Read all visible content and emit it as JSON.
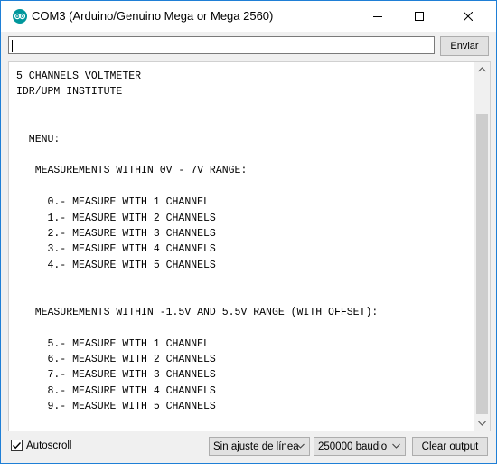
{
  "window": {
    "title": "COM3 (Arduino/Genuino Mega or Mega 2560)",
    "icon": "arduino-icon",
    "accent_color": "#00979c"
  },
  "send": {
    "input_value": "",
    "button_label": "Enviar"
  },
  "output": {
    "lines": [
      "5 CHANNELS VOLTMETER",
      "IDR/UPM INSTITUTE",
      "",
      "",
      "  MENU:",
      "",
      "   MEASUREMENTS WITHIN 0V - 7V RANGE:",
      "",
      "     0.- MEASURE WITH 1 CHANNEL",
      "     1.- MEASURE WITH 2 CHANNELS",
      "     2.- MEASURE WITH 3 CHANNELS",
      "     3.- MEASURE WITH 4 CHANNELS",
      "     4.- MEASURE WITH 5 CHANNELS",
      "",
      "",
      "   MEASUREMENTS WITHIN -1.5V AND 5.5V RANGE (WITH OFFSET):",
      "",
      "     5.- MEASURE WITH 1 CHANNEL",
      "     6.- MEASURE WITH 2 CHANNELS",
      "     7.- MEASURE WITH 3 CHANNELS",
      "     8.- MEASURE WITH 4 CHANNELS",
      "     9.- MEASURE WITH 5 CHANNELS"
    ]
  },
  "bottom": {
    "autoscroll_label": "Autoscroll",
    "autoscroll_checked": true,
    "line_ending": "Sin ajuste de línea",
    "baud_rate": "250000 baudio",
    "clear_label": "Clear output"
  }
}
